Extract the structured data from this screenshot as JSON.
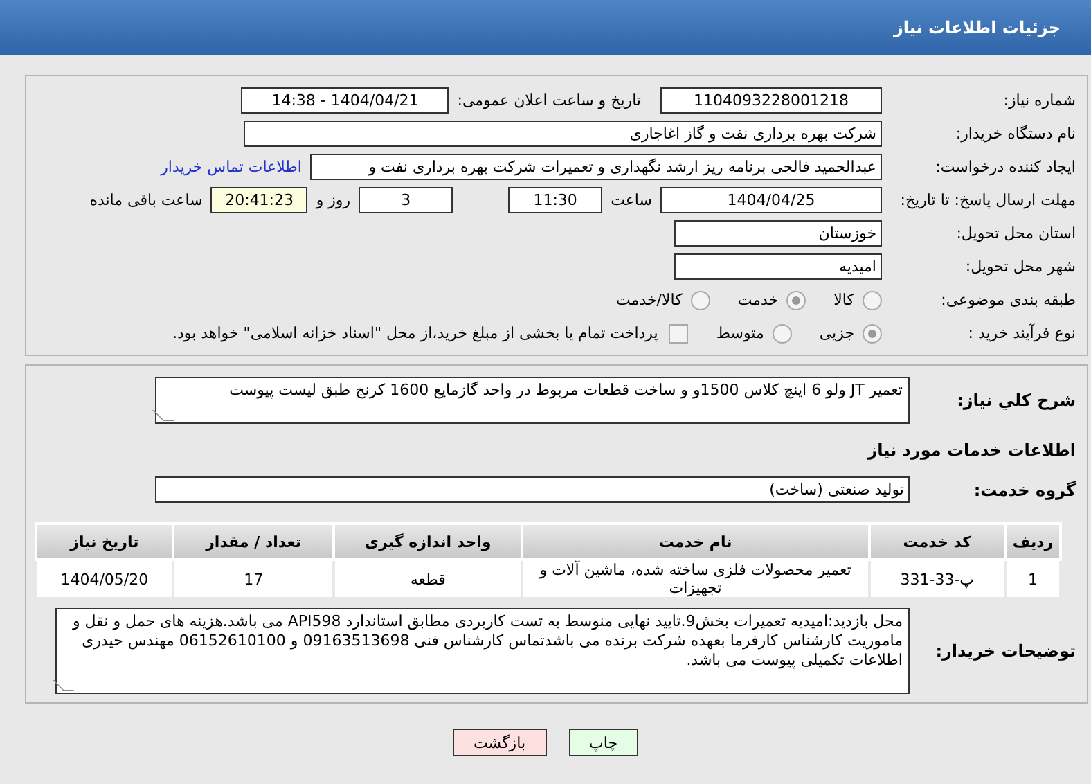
{
  "header": {
    "title": "جزئیات اطلاعات نیاز"
  },
  "details": {
    "need_number": {
      "label": "شماره نیاز:",
      "value": "1104093228001218"
    },
    "announce": {
      "label": "تاریخ و ساعت اعلان عمومی:",
      "value": "1404/04/21 - 14:38"
    },
    "buyer": {
      "label": "نام دستگاه خریدار:",
      "value": "شرکت بهره برداری نفت و گاز اغاجاری"
    },
    "requester": {
      "label": "ایجاد کننده درخواست:",
      "value": "عبدالحمید فالحی برنامه ریز ارشد نگهداری و تعمیرات شرکت بهره برداری نفت و",
      "link": "اطلاعات تماس خریدار"
    },
    "deadline": {
      "label": "مهلت ارسال پاسخ: تا تاریخ:",
      "date": "1404/04/25",
      "time_label": "ساعت",
      "time": "11:30",
      "days": "3",
      "days_label": "روز و",
      "remaining": "20:41:23",
      "remaining_label": "ساعت باقی مانده"
    },
    "province": {
      "label": "استان محل تحویل:",
      "value": "خوزستان"
    },
    "city": {
      "label": "شهر محل تحویل:",
      "value": "امیدیه"
    },
    "category": {
      "label": "طبقه بندی موضوعی:",
      "options": [
        {
          "label": "کالا",
          "selected": false
        },
        {
          "label": "خدمت",
          "selected": true
        },
        {
          "label": "کالا/خدمت",
          "selected": false
        }
      ]
    },
    "process": {
      "label": "نوع فرآیند خرید :",
      "options": [
        {
          "label": "جزیی",
          "selected": true
        },
        {
          "label": "متوسط",
          "selected": false
        }
      ],
      "treasury": {
        "label": "پرداخت تمام یا بخشی از مبلغ خرید،از محل \"اسناد خزانه اسلامی\" خواهد بود.",
        "checked": false
      }
    }
  },
  "needs": {
    "summary": {
      "label": "شرح کلي نیاز:",
      "value": "تعمیر JT ولو 6 اینچ کلاس 1500و و ساخت قطعات مربوط در واحد گازمایع 1600 کرنج طبق لیست پیوست"
    },
    "section_title": "اطلاعات خدمات مورد نیاز",
    "service_group": {
      "label": "گروه خدمت:",
      "value": "تولید صنعتی (ساخت)"
    },
    "table": {
      "columns": [
        "ردیف",
        "کد خدمت",
        "نام خدمت",
        "واحد اندازه گیری",
        "تعداد / مقدار",
        "تاریخ نیاز"
      ],
      "rows": [
        [
          "1",
          "پ-33-331",
          "تعمیر محصولات فلزی ساخته شده، ماشین آلات و تجهیزات",
          "قطعه",
          "17",
          "1404/05/20"
        ]
      ]
    },
    "notes": {
      "label": "توضیحات خریدار:",
      "value": "محل بازدید:امیدیه تعمیرات بخش9.تایید نهایی منوسط به تست کاربردی مطابق استاندارد API598 می باشد.هزینه های حمل و نقل و ماموریت کارشناس کارفرما بعهده شرکت برنده می باشدتماس کارشناس فنی 09163513698 و 06152610100 مهندس حیدری  اطلاعات تکمیلی پیوست می باشد."
    }
  },
  "buttons": [
    {
      "label": "چاپ",
      "kind": "print"
    },
    {
      "label": "بازگشت",
      "kind": "back"
    }
  ]
}
